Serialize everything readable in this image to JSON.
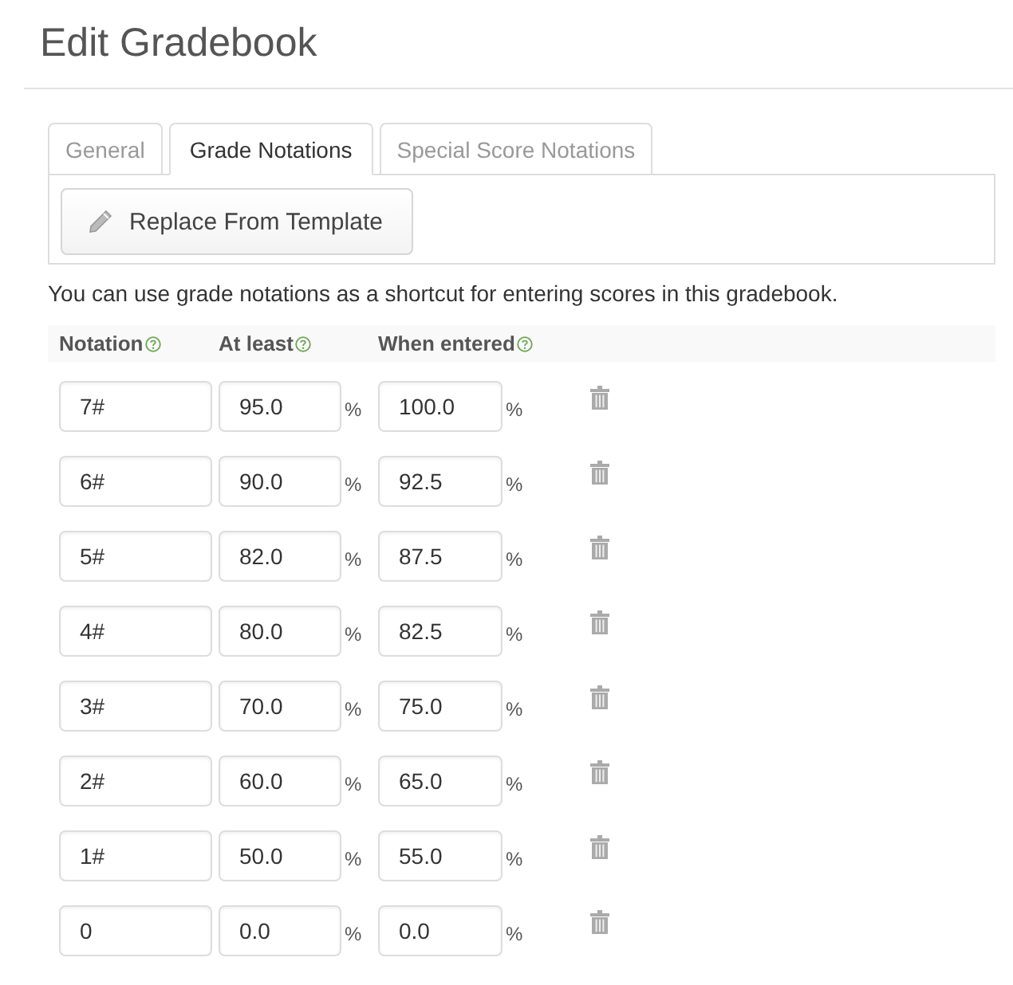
{
  "page": {
    "title": "Edit Gradebook"
  },
  "tabs": [
    {
      "label": "General",
      "selected": false
    },
    {
      "label": "Grade Notations",
      "selected": true
    },
    {
      "label": "Special Score Notations",
      "selected": false
    }
  ],
  "toolbar": {
    "replace_button": "Replace From Template"
  },
  "description": "You can use grade notations as a shortcut for entering scores in this gradebook.",
  "table": {
    "columns": [
      {
        "label": "Notation"
      },
      {
        "label": "At least"
      },
      {
        "label": "When entered"
      }
    ],
    "rows": [
      {
        "notation": "7#",
        "at_least": "95.0",
        "at_least_unit": "%",
        "when_entered": "100.0",
        "when_entered_unit": "%"
      },
      {
        "notation": "6#",
        "at_least": "90.0",
        "at_least_unit": "%",
        "when_entered": "92.5",
        "when_entered_unit": "%"
      },
      {
        "notation": "5#",
        "at_least": "82.0",
        "at_least_unit": "%",
        "when_entered": "87.5",
        "when_entered_unit": "%"
      },
      {
        "notation": "4#",
        "at_least": "80.0",
        "at_least_unit": "%",
        "when_entered": "82.5",
        "when_entered_unit": "%"
      },
      {
        "notation": "3#",
        "at_least": "70.0",
        "at_least_unit": "%",
        "when_entered": "75.0",
        "when_entered_unit": "%"
      },
      {
        "notation": "2#",
        "at_least": "60.0",
        "at_least_unit": "%",
        "when_entered": "65.0",
        "when_entered_unit": "%"
      },
      {
        "notation": "1#",
        "at_least": "50.0",
        "at_least_unit": "%",
        "when_entered": "55.0",
        "when_entered_unit": "%"
      },
      {
        "notation": "0",
        "at_least": "0.0",
        "at_least_unit": "%",
        "when_entered": "0.0",
        "when_entered_unit": "%"
      }
    ]
  }
}
